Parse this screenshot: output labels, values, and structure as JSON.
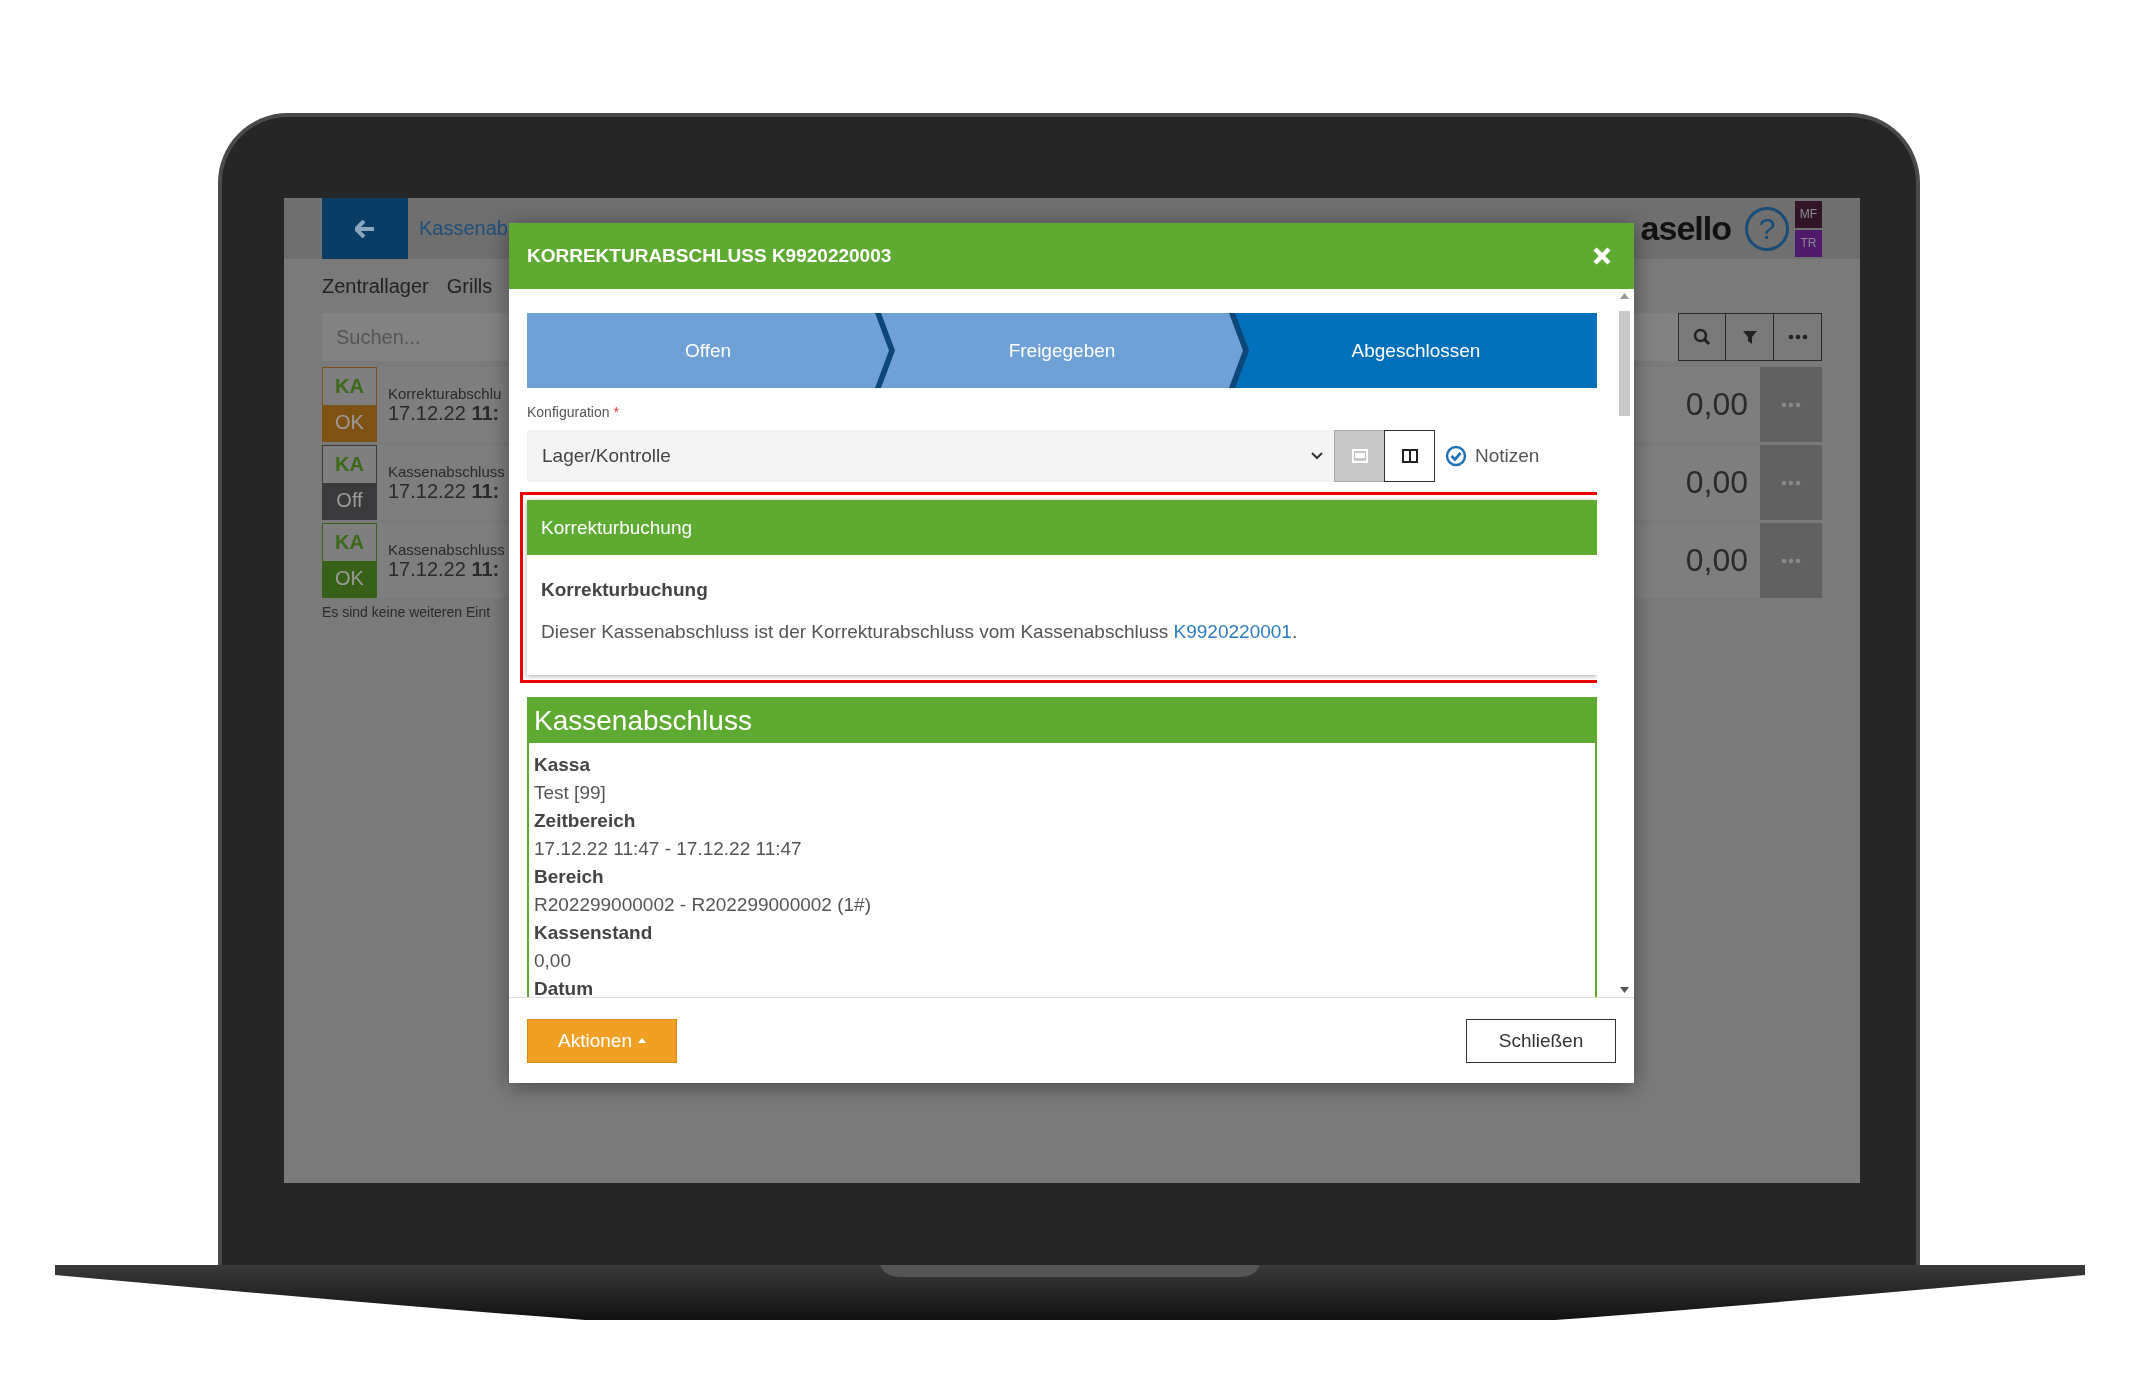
{
  "app": {
    "title": "Kassenab",
    "logo": "asello",
    "help": "?",
    "user_badges": [
      {
        "label": "MF",
        "color": "#321428"
      },
      {
        "label": "TR",
        "color": "#4f1a6b"
      }
    ],
    "location_tabs": [
      "Zentrallager",
      "Grills"
    ],
    "search": {
      "placeholder": "Suchen..."
    },
    "entries": [
      {
        "code": "KA",
        "status": "OK",
        "color": "#7e5212",
        "title": "Korrekturabschlu",
        "date": "17.12.22",
        "time": "11:",
        "amount": "0,00"
      },
      {
        "code": "KA",
        "status": "Off",
        "color": "#3a3a3c",
        "title": "Kassenabschluss",
        "date": "17.12.22",
        "time": "11:",
        "amount": "0,00"
      },
      {
        "code": "KA",
        "status": "OK",
        "color": "#376119",
        "title": "Kassenabschluss",
        "date": "17.12.22",
        "time": "11:",
        "amount": "0,00"
      }
    ],
    "list_footer": "Es sind keine weiteren Eint"
  },
  "dialog": {
    "title": "KORREKTURABSCHLUSS K9920220003",
    "steps": [
      {
        "label": "Offen",
        "selected": false
      },
      {
        "label": "Freigegeben",
        "selected": false
      },
      {
        "label": "Abgeschlossen",
        "selected": true
      }
    ],
    "config": {
      "label": "Konfiguration",
      "required_mark": "*",
      "value": "Lager/Kontrolle"
    },
    "view_modes": [
      {
        "kind": "single",
        "selected": true
      },
      {
        "kind": "split",
        "selected": false
      }
    ],
    "notes": {
      "label": "Notizen",
      "checked": true
    },
    "notice": {
      "header": "Korrekturbuchung",
      "heading": "Korrekturbuchung",
      "text": "Dieser Kassenabschluss ist der Korrekturabschluss vom Kassenabschluss ",
      "link": "K9920220001",
      "text_end": "."
    },
    "summary": {
      "title": "Kassenabschluss",
      "fields": [
        {
          "label": "Kassa",
          "value": "Test [99]"
        },
        {
          "label": "Zeitbereich",
          "value": "17.12.22 11:47 - 17.12.22 11:47"
        },
        {
          "label": "Bereich",
          "value": "R202299000002 - R202299000002 (1#)"
        },
        {
          "label": "Kassenstand",
          "value": "0,00"
        },
        {
          "label": "Datum"
        }
      ]
    },
    "actions_button": "Aktionen",
    "close_button": "Schließen"
  }
}
